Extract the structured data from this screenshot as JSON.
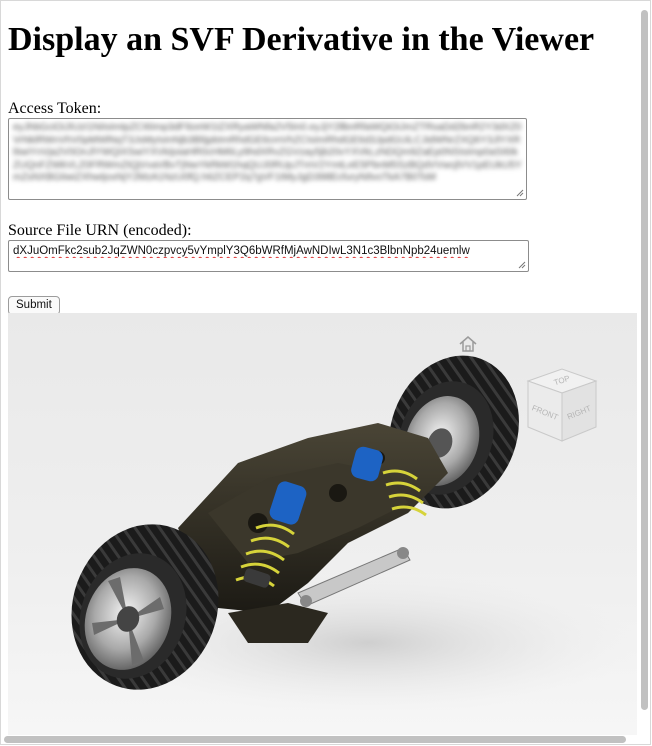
{
  "page": {
    "title": "Display an SVF Derivative in the Viewer"
  },
  "form": {
    "token_label": "Access Token:",
    "token_value": "eyJhbGciOiJIUzI1NiIsImtpZCI6Imp3dF9zeW1tZXRyaWNfa2V5In0.eyJjY2llbnRfaWQiOiJmZTRsaDd2bnR2Y3dXZ0VrNklRWnVhV0pMWlNqT3JsMyIsInNjb3BlIjpbImRhdGE6cmVhZCIsImRhdGE6d3JpdGUiLCJidWNrZXQ6Y3JlYXRlIiwiYnVja2V0OnJlYWQiXSwiYXVkIjoiaHR0cHM6Ly9hdXRvZGVzay5jb20vYXVkLzNDQm9ZaEp0NSIsImp0aSI6IkZUQnFZWkVLZ0FRWmZtQjVvaVBvTjNwYkRkM1hqQUJ0RUpJTmV2YmtLeE5PbnM5SzBQdVVwcjlVV1pEUkU5YmZsNXBGIiwiZXhwIjoxNjY2MzA1NzU0fQ.h6ZCEP2q7gVF1tMyJgD398EcfuryNIlvoTkA7B0TsM",
    "urn_label": "Source File URN (encoded):",
    "urn_value": "dXJuOmFkc2sub2JqZWN0czpvcy5vYmplY3Q6bWRfMjAwNDIwL3N1c3BlbnNpb24uemlw",
    "submit_label": "Submit"
  },
  "viewer": {
    "home_icon": "home-icon",
    "viewcube_labels": {
      "top": "TOP",
      "front": "FRONT",
      "right": "RIGHT"
    }
  },
  "colors": {
    "viewer_bg": "#ececec",
    "spring": "#d6d33a",
    "shock": "#1d63c4",
    "frame_metal": "#2e2a22"
  }
}
